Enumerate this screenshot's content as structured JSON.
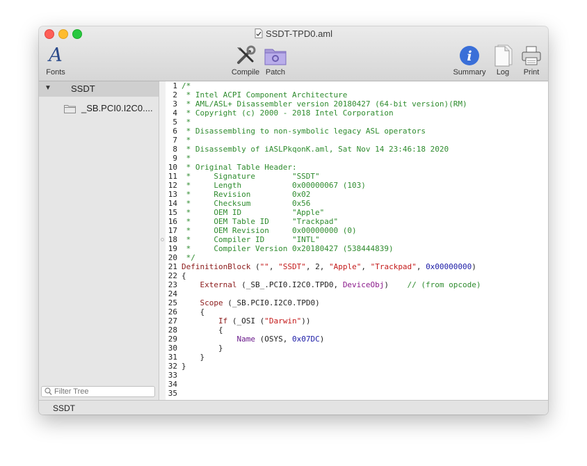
{
  "window": {
    "title": "SSDT-TPD0.aml"
  },
  "toolbar": {
    "fonts_label": "Fonts",
    "compile_label": "Compile",
    "patch_label": "Patch",
    "summary_label": "Summary",
    "log_label": "Log",
    "print_label": "Print"
  },
  "sidebar": {
    "header": "SSDT",
    "items": [
      {
        "label": "_SB.PCI0.I2C0...."
      }
    ],
    "filter_placeholder": "Filter Tree"
  },
  "status": {
    "text": "SSDT"
  },
  "editor": {
    "lines": [
      {
        "n": "1",
        "segs": [
          {
            "t": "/*",
            "c": "com"
          }
        ]
      },
      {
        "n": "2",
        "segs": [
          {
            "t": " * Intel ACPI Component Architecture",
            "c": "com"
          }
        ]
      },
      {
        "n": "3",
        "segs": [
          {
            "t": " * AML/ASL+ Disassembler version 20180427 (64-bit version)(RM)",
            "c": "com"
          }
        ]
      },
      {
        "n": "4",
        "segs": [
          {
            "t": " * Copyright (c) 2000 - 2018 Intel Corporation",
            "c": "com"
          }
        ]
      },
      {
        "n": "5",
        "segs": [
          {
            "t": " *",
            "c": "com"
          }
        ]
      },
      {
        "n": "6",
        "segs": [
          {
            "t": " * Disassembling to non-symbolic legacy ASL operators",
            "c": "com"
          }
        ]
      },
      {
        "n": "7",
        "segs": [
          {
            "t": " *",
            "c": "com"
          }
        ]
      },
      {
        "n": "8",
        "segs": [
          {
            "t": " * Disassembly of iASLPkqonK.aml, Sat Nov 14 23:46:18 2020",
            "c": "com"
          }
        ]
      },
      {
        "n": "9",
        "segs": [
          {
            "t": " *",
            "c": "com"
          }
        ]
      },
      {
        "n": "10",
        "segs": [
          {
            "t": " * Original Table Header:",
            "c": "com"
          }
        ]
      },
      {
        "n": "11",
        "segs": [
          {
            "t": " *     Signature        \"SSDT\"",
            "c": "com"
          }
        ]
      },
      {
        "n": "12",
        "segs": [
          {
            "t": " *     Length           0x00000067 (103)",
            "c": "com"
          }
        ]
      },
      {
        "n": "13",
        "segs": [
          {
            "t": " *     Revision         0x02",
            "c": "com"
          }
        ]
      },
      {
        "n": "14",
        "segs": [
          {
            "t": " *     Checksum         0x56",
            "c": "com"
          }
        ]
      },
      {
        "n": "15",
        "segs": [
          {
            "t": " *     OEM ID           \"Apple\"",
            "c": "com"
          }
        ]
      },
      {
        "n": "16",
        "segs": [
          {
            "t": " *     OEM Table ID     \"Trackpad\"",
            "c": "com"
          }
        ]
      },
      {
        "n": "17",
        "segs": [
          {
            "t": " *     OEM Revision     0x00000000 (0)",
            "c": "com"
          }
        ]
      },
      {
        "n": "18",
        "segs": [
          {
            "t": " *     Compiler ID      \"INTL\"",
            "c": "com"
          }
        ]
      },
      {
        "n": "19",
        "segs": [
          {
            "t": " *     Compiler Version 0x20180427 (538444839)",
            "c": "com"
          }
        ]
      },
      {
        "n": "20",
        "segs": [
          {
            "t": " */",
            "c": "com"
          }
        ]
      },
      {
        "n": "21",
        "segs": [
          {
            "t": "DefinitionBlock",
            "c": "kw"
          },
          {
            "t": " (",
            "c": ""
          },
          {
            "t": "\"\"",
            "c": "str"
          },
          {
            "t": ", ",
            "c": ""
          },
          {
            "t": "\"SSDT\"",
            "c": "str"
          },
          {
            "t": ", 2, ",
            "c": ""
          },
          {
            "t": "\"Apple\"",
            "c": "str"
          },
          {
            "t": ", ",
            "c": ""
          },
          {
            "t": "\"Trackpad\"",
            "c": "str"
          },
          {
            "t": ", ",
            "c": ""
          },
          {
            "t": "0x00000000",
            "c": "num"
          },
          {
            "t": ")",
            "c": ""
          }
        ]
      },
      {
        "n": "22",
        "segs": [
          {
            "t": "{",
            "c": ""
          }
        ]
      },
      {
        "n": "23",
        "segs": [
          {
            "t": "    ",
            "c": ""
          },
          {
            "t": "External",
            "c": "kw"
          },
          {
            "t": " (_SB_.PCI0.I2C0.TPD0, ",
            "c": ""
          },
          {
            "t": "DeviceObj",
            "c": "dev"
          },
          {
            "t": ")    ",
            "c": ""
          },
          {
            "t": "// (from opcode)",
            "c": "com"
          }
        ]
      },
      {
        "n": "24",
        "segs": [
          {
            "t": "",
            "c": ""
          }
        ]
      },
      {
        "n": "25",
        "segs": [
          {
            "t": "    ",
            "c": ""
          },
          {
            "t": "Scope",
            "c": "kw"
          },
          {
            "t": " (_SB.PCI0.I2C0.TPD0)",
            "c": ""
          }
        ]
      },
      {
        "n": "26",
        "segs": [
          {
            "t": "    {",
            "c": ""
          }
        ]
      },
      {
        "n": "27",
        "segs": [
          {
            "t": "        ",
            "c": ""
          },
          {
            "t": "If",
            "c": "kw"
          },
          {
            "t": " (_OSI (",
            "c": ""
          },
          {
            "t": "\"Darwin\"",
            "c": "str"
          },
          {
            "t": "))",
            "c": ""
          }
        ]
      },
      {
        "n": "28",
        "segs": [
          {
            "t": "        {",
            "c": ""
          }
        ]
      },
      {
        "n": "29",
        "segs": [
          {
            "t": "            ",
            "c": ""
          },
          {
            "t": "Name",
            "c": "nm"
          },
          {
            "t": " (OSYS, ",
            "c": ""
          },
          {
            "t": "0x07DC",
            "c": "num"
          },
          {
            "t": ")",
            "c": ""
          }
        ]
      },
      {
        "n": "30",
        "segs": [
          {
            "t": "        }",
            "c": ""
          }
        ]
      },
      {
        "n": "31",
        "segs": [
          {
            "t": "    }",
            "c": ""
          }
        ]
      },
      {
        "n": "32",
        "segs": [
          {
            "t": "}",
            "c": ""
          }
        ]
      },
      {
        "n": "33",
        "segs": [
          {
            "t": "",
            "c": ""
          }
        ]
      },
      {
        "n": "34",
        "segs": [
          {
            "t": "",
            "c": ""
          }
        ]
      },
      {
        "n": "35",
        "segs": [
          {
            "t": "",
            "c": ""
          }
        ]
      }
    ]
  }
}
